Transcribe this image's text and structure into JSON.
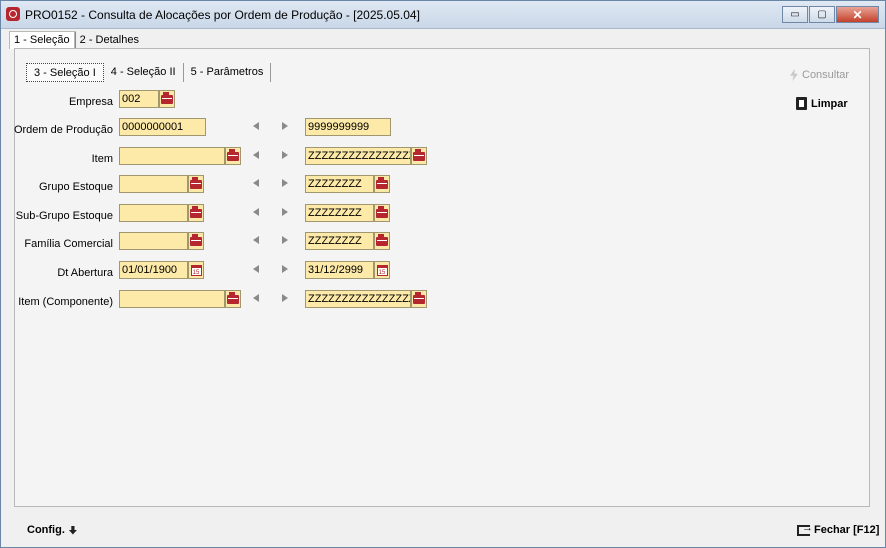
{
  "window": {
    "title": "PRO0152 - Consulta de Alocações por Ordem de Produção - [2025.05.04]",
    "minimize_glyph": "▭",
    "maximize_glyph": "▢",
    "close_glyph": "✕"
  },
  "top_tabs": [
    {
      "label": "1 - Seleção"
    },
    {
      "label": "2 - Detalhes"
    }
  ],
  "sub_tabs": [
    {
      "label": "3 - Seleção I"
    },
    {
      "label": "4 - Seleção II"
    },
    {
      "label": "5 - Parâmetros"
    }
  ],
  "actions": {
    "consultar": "Consultar",
    "limpar": "Limpar"
  },
  "form": {
    "empresa": {
      "label": "Empresa",
      "value": "002"
    },
    "ordem": {
      "label": "Ordem de Produção",
      "from": "0000000001",
      "to": "9999999999"
    },
    "item": {
      "label": "Item",
      "from": "",
      "to": "ZZZZZZZZZZZZZZZZZZZZ"
    },
    "grupo": {
      "label": "Grupo Estoque",
      "from": "",
      "to": "ZZZZZZZZ"
    },
    "subgrupo": {
      "label": "Sub-Grupo Estoque",
      "from": "",
      "to": "ZZZZZZZZ"
    },
    "familia": {
      "label": "Família Comercial",
      "from": "",
      "to": "ZZZZZZZZ"
    },
    "dtabertura": {
      "label": "Dt Abertura",
      "from": "01/01/1900",
      "to": "31/12/2999",
      "cal_day": "15"
    },
    "itemcomp": {
      "label": "Item (Componente)",
      "from": "",
      "to": "ZZZZZZZZZZZZZZZZZZZZ"
    }
  },
  "footer": {
    "config": "Config.",
    "fechar": "Fechar [F12]"
  }
}
